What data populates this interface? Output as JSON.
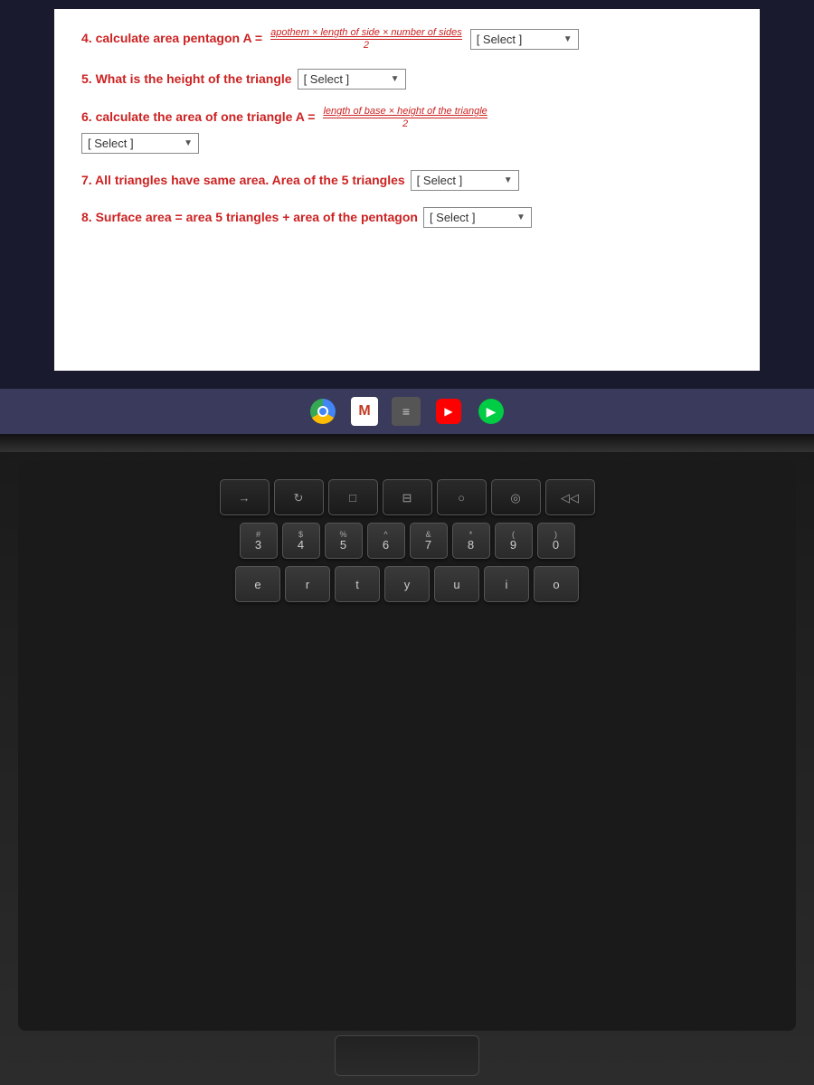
{
  "screen": {
    "content": {
      "q4": {
        "label": "4. calculate area pentagon A =",
        "formula_numerator": "apothem × length of side × number of sides",
        "formula_denominator": "2",
        "select_label": "[ Select ]"
      },
      "q5": {
        "label": "5. What is the height of the triangle",
        "select_label": "[ Select ]"
      },
      "q6": {
        "label": "6. calculate the area of one triangle A =",
        "formula_numerator": "length of base × height of the triangle",
        "formula_denominator": "2",
        "select_label": "[ Select ]"
      },
      "q7": {
        "label": "7. All triangles have same area. Area of the 5 triangles",
        "select_label": "[ Select ]"
      },
      "q8": {
        "label": "8. Surface area = area 5 triangles + area of the pentagon",
        "select_label": "[ Select ]"
      }
    }
  },
  "taskbar": {
    "icons": [
      "chrome",
      "gmail",
      "files",
      "youtube",
      "play"
    ]
  },
  "keyboard": {
    "row1_special": [
      "→",
      "↻",
      "□",
      "◫",
      "○",
      "◎",
      "◁◁"
    ],
    "row2": [
      {
        "top": "#",
        "main": "3"
      },
      {
        "top": "$",
        "main": "4"
      },
      {
        "top": "%",
        "main": "5"
      },
      {
        "top": "^",
        "main": "6"
      },
      {
        "top": "&",
        "main": "7"
      },
      {
        "top": "*",
        "main": "8"
      },
      {
        "top": "(",
        "main": "9"
      },
      {
        "top": ")",
        "main": "0"
      }
    ],
    "row3": [
      {
        "top": "",
        "main": "e"
      },
      {
        "top": "",
        "main": "r"
      },
      {
        "top": "",
        "main": "t"
      },
      {
        "top": "",
        "main": "y"
      },
      {
        "top": "",
        "main": "u"
      },
      {
        "top": "",
        "main": "i"
      },
      {
        "top": "",
        "main": "o"
      }
    ]
  }
}
